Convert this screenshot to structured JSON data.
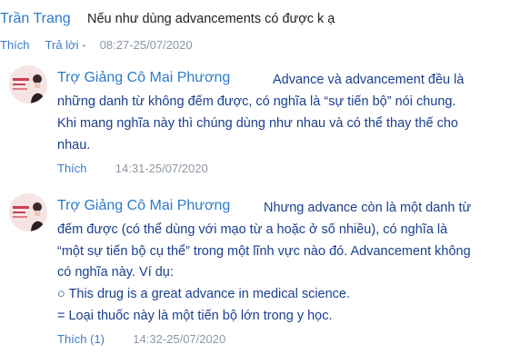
{
  "comment": {
    "author": "Trần Trang",
    "text": "Nếu như dùng advancements có được k ạ",
    "like": "Thích",
    "reply": "Trả lời -",
    "time": "08:27-25/07/2020"
  },
  "replies": [
    {
      "author": "Trợ Giảng Cô Mai Phương",
      "lines": [
        "Advance và advancement đều là",
        "những danh từ không đếm được, có nghĩa là “sự tiến bộ” nói chung.",
        "Khi mang nghĩa này thì chúng dùng như nhau và có thể thay thế cho",
        "nhau."
      ],
      "like": "Thích",
      "time": "14:31-25/07/2020"
    },
    {
      "author": "Trợ Giảng Cô Mai Phương",
      "lines": [
        "Nhưng advance còn là một danh từ",
        "đếm được (có thể dùng với mạo từ a hoặc ở số nhiều), có nghĩa là",
        "“một sự tiến bộ cụ thể” trong một lĩnh vực nào đó. Advancement không",
        "có nghĩa này. Ví dụ:",
        "○ This drug is a great advance in medical science.",
        "= Loại thuốc này là một tiến bộ lớn trong y học."
      ],
      "like": "Thích (1)",
      "time": "14:32-25/07/2020"
    }
  ]
}
